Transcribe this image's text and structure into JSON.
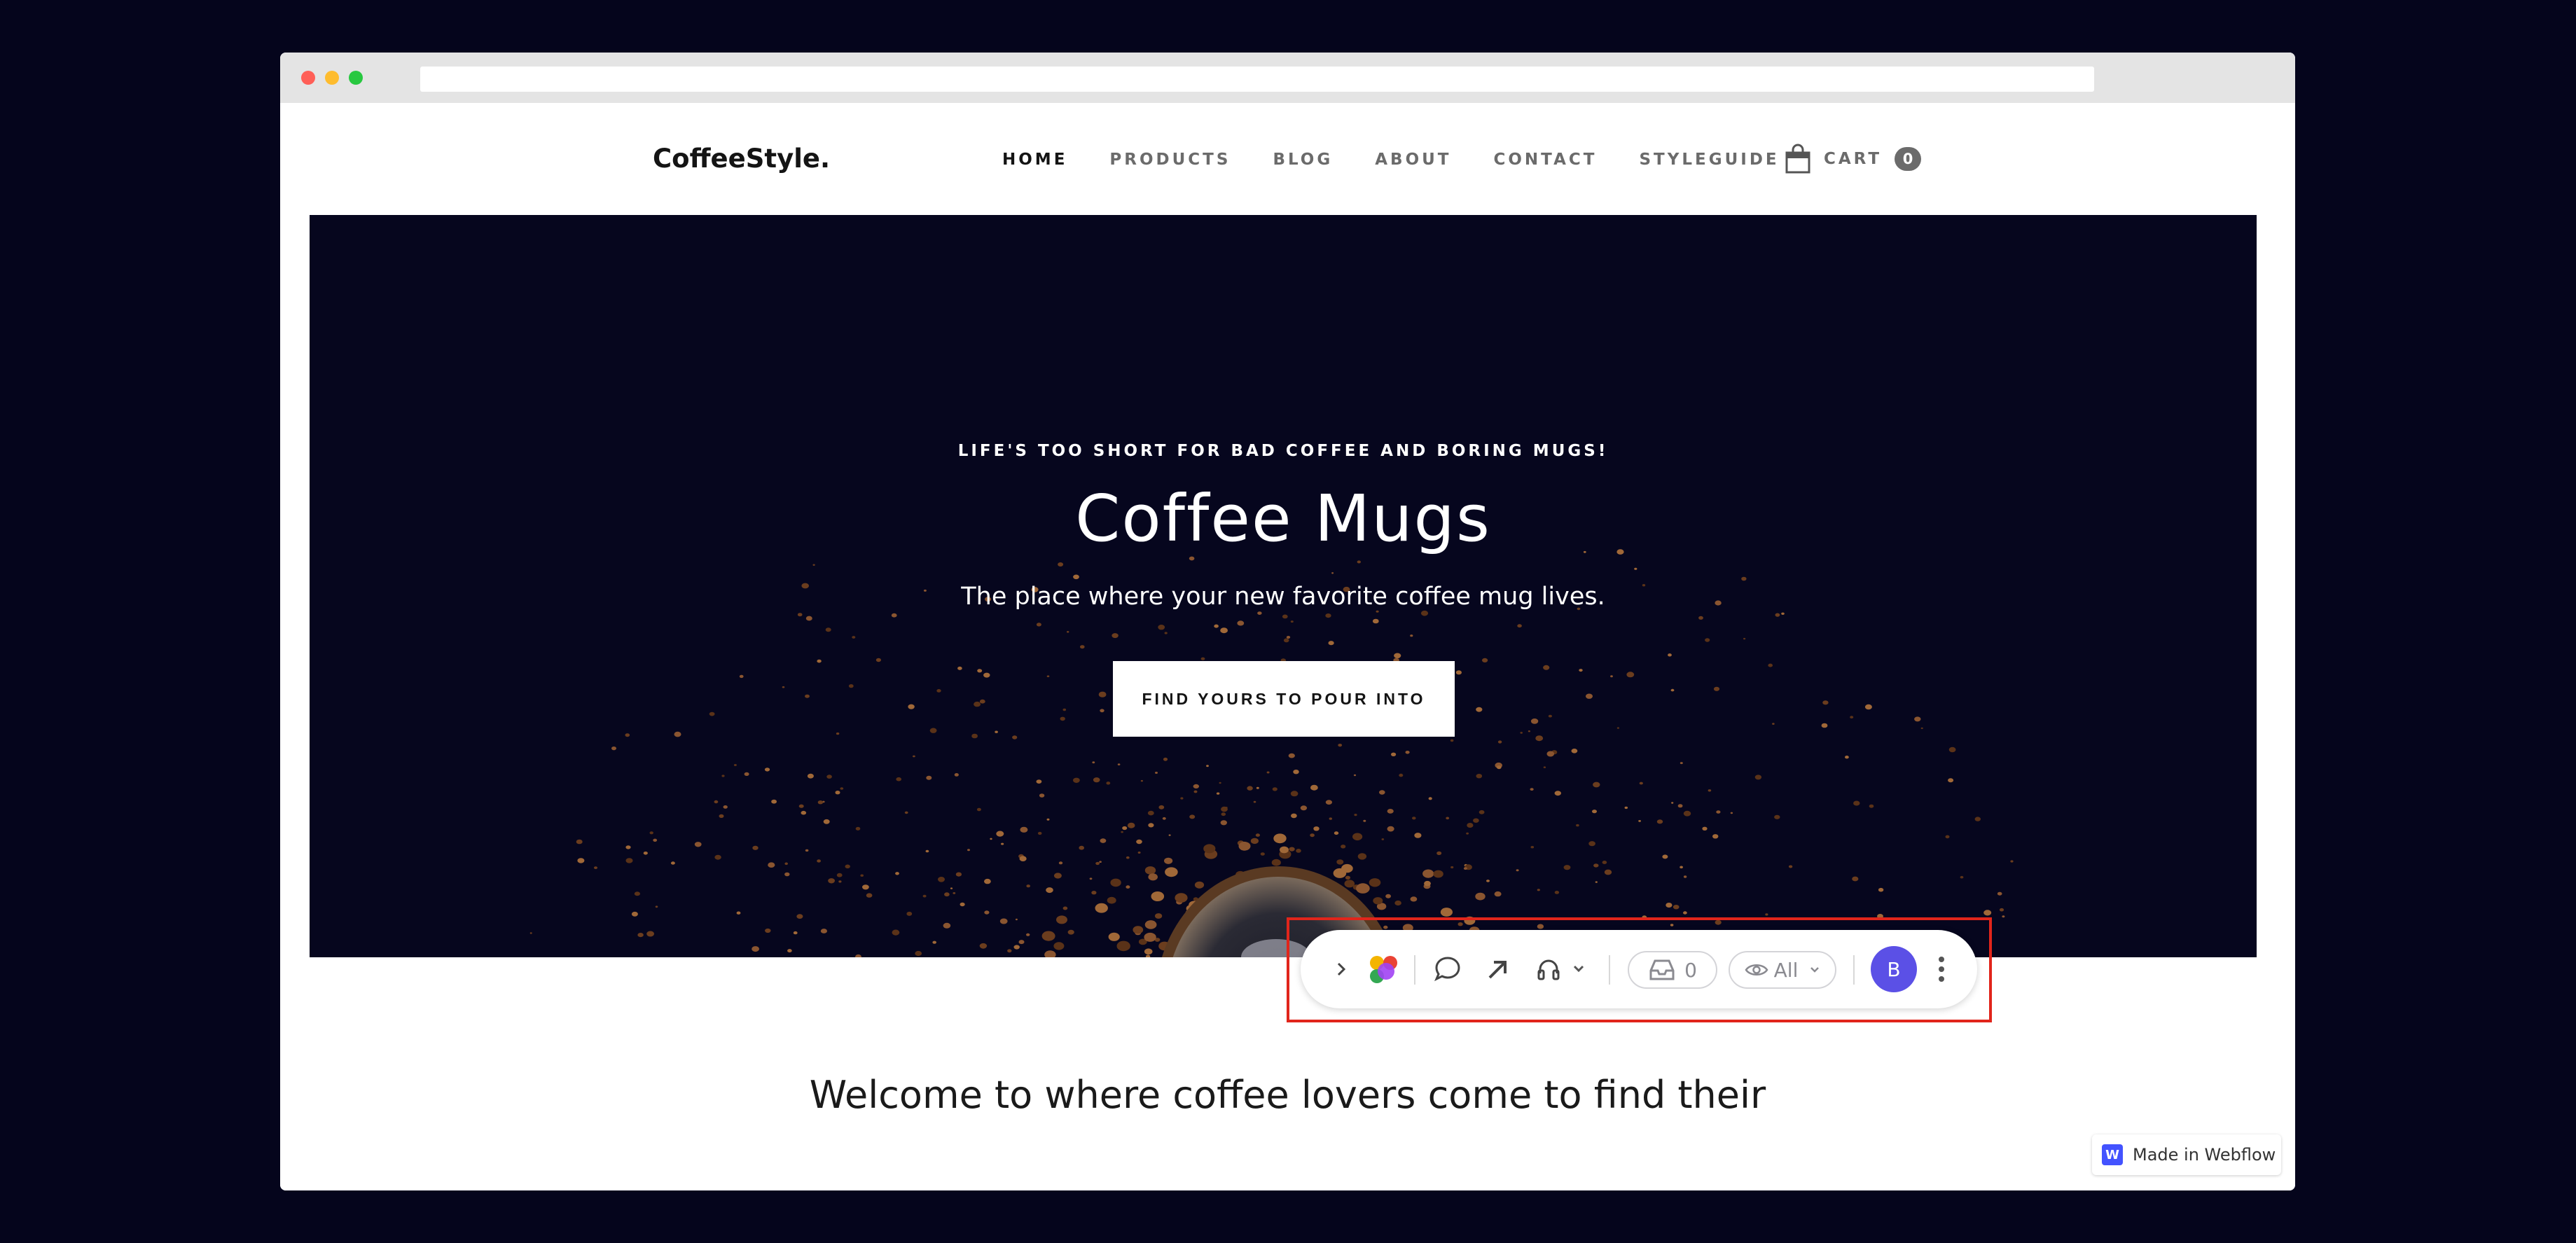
{
  "colors": {
    "background": "#05051c",
    "hero_background": "#06061e",
    "avatar": "#5b50e6",
    "highlight": "#e1251b",
    "webflow_blue": "#4353ff"
  },
  "nav": {
    "brand": "CoffeeStyle.",
    "links": [
      {
        "label": "HOME",
        "active": true
      },
      {
        "label": "PRODUCTS"
      },
      {
        "label": "BLOG"
      },
      {
        "label": "ABOUT"
      },
      {
        "label": "CONTACT"
      },
      {
        "label": "STYLEGUIDE"
      }
    ],
    "cart_label": "CART",
    "cart_count": "0",
    "cart_icon": "shopping-bag-icon"
  },
  "hero": {
    "eyebrow": "LIFE'S TOO SHORT FOR BAD COFFEE AND BORING MUGS!",
    "title": "Coffee Mugs",
    "subtitle": "The place where your new favorite coffee mug lives.",
    "button_label": "FIND YOURS TO POUR INTO"
  },
  "welcome_heading": "Welcome to where coffee lovers come to find their",
  "toolbar": {
    "icons": [
      "chevron-right-icon",
      "app-logo-icon",
      "comment-icon",
      "arrow-up-right-icon",
      "headset-icon",
      "chevron-down-icon",
      "inbox-icon",
      "eye-icon",
      "chevron-down-icon",
      "more-vertical-icon"
    ],
    "inbox_count": "0",
    "visibility_label": "All",
    "avatar_initial": "B"
  },
  "webflow_badge": {
    "logo_letter": "W",
    "label": "Made in Webflow"
  }
}
